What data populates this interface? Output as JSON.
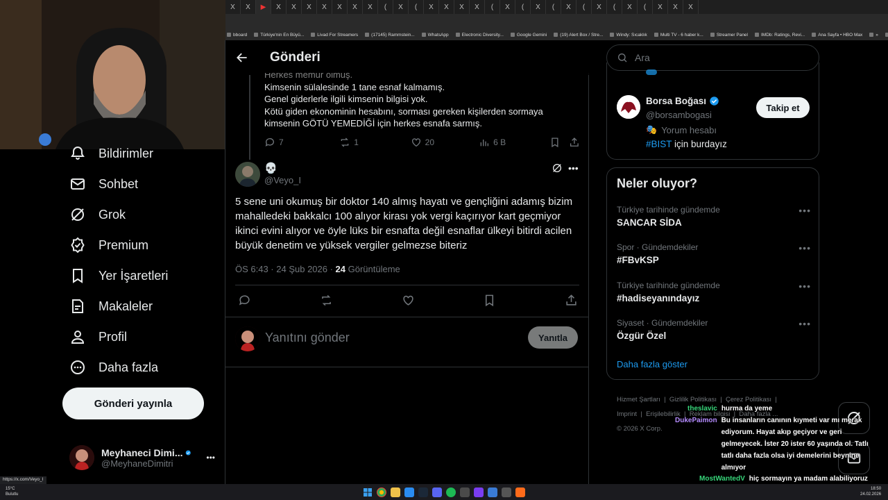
{
  "browser": {
    "tabs": [
      "X",
      "X",
      "▶",
      "X",
      "X",
      "X",
      "X",
      "X",
      "X",
      "X",
      "(",
      "X",
      "(",
      "X",
      "X",
      "X",
      "X",
      "(",
      "X",
      "(",
      "X",
      "(",
      "X",
      "(",
      "X",
      "(",
      "X",
      "(",
      "X",
      "X",
      "X"
    ],
    "bookmarks": [
      "bboard",
      "Türkiye'nin En Büyü...",
      "Livad For Streamers",
      "(17145) Rammstein...",
      "WhatsApp",
      "Electronic Diversity...",
      "Google Gemini",
      "(19) Alert Box / Stre...",
      "Windy: Sıcaklık",
      "Multi TV - 6 haber k...",
      "Streamer Panel",
      "IMDb: Ratings, Revi...",
      "Ana Sayfa • HBO Max",
      "»",
      "Tüm Yer İşaretleri"
    ]
  },
  "nav": {
    "items": [
      {
        "label": "Bildirimler",
        "icon": "bell-icon"
      },
      {
        "label": "Sohbet",
        "icon": "mail-icon"
      },
      {
        "label": "Grok",
        "icon": "grok-icon"
      },
      {
        "label": "Premium",
        "icon": "premium-icon"
      },
      {
        "label": "Yer İşaretleri",
        "icon": "bookmark-icon"
      },
      {
        "label": "Makaleler",
        "icon": "article-icon"
      },
      {
        "label": "Profil",
        "icon": "person-icon"
      },
      {
        "label": "Daha fazla",
        "icon": "more-icon"
      }
    ],
    "post_button": "Gönderi yayınla",
    "account": {
      "name": "Meyhaneci Dimi...",
      "handle": "@MeyhaneDimitri",
      "more": "•••"
    }
  },
  "main": {
    "title": "Gönderi",
    "quoted": {
      "lines": [
        "Herkes memur olmuş.",
        "Kimsenin sülalesinde 1 tane esnaf kalmamış.",
        "Genel giderlerle ilgili kimsenin bilgisi yok.",
        "Kötü giden ekonominin hesabını, sorması gereken kişilerden sormaya",
        "kimsenin GÖTÜ YEMEDİĞİ için herkes esnafa sarmış."
      ],
      "replies": "7",
      "reposts": "1",
      "likes": "20",
      "views": "6 B"
    },
    "tweet": {
      "name_emoji": "💀",
      "handle": "@Veyo_I",
      "text": "5 sene uni okumuş bir doktor 140 almış hayatı ve gençliğini adamış bizim mahalledeki bakkalcı 100 alıyor kirası yok vergi kaçırıyor kart geçmiyor ikinci evini alıyor ve öyle lüks bir esnafta değil esnaflar ülkeyi bitirdi acilen büyük denetim ve yüksek vergiler gelmezse biteriz",
      "time": "ÖS 6:43 · 24 Şub 2026 · ",
      "views_count": "24",
      "views_label": " Görüntüleme"
    },
    "reply": {
      "placeholder": "Yanıtını gönder",
      "button": "Yanıtla"
    }
  },
  "right": {
    "search_placeholder": "Ara",
    "suggestion": {
      "name": "Borsa Boğası",
      "handle": "@borsambogasi",
      "badge": "Yorum hesabı",
      "bio_tag": "#BIST",
      "bio_rest": " için burdayız",
      "follow": "Takip et"
    },
    "trends_title": "Neler oluyor?",
    "trends": [
      {
        "meta": "Türkiye tarihinde gündemde",
        "name": "SANCAR SİDA"
      },
      {
        "meta": "Spor · Gündemdekiler",
        "name": "#FBvKSP"
      },
      {
        "meta": "Türkiye tarihinde gündemde",
        "name": "#hadiseyanındayız"
      },
      {
        "meta": "Siyaset · Gündemdekiler",
        "name": "Özgür Özel"
      }
    ],
    "show_more": "Daha fazla göster",
    "footer": [
      "Hizmet Şartları",
      "Gizlilik Politikası",
      "Çerez Politikası",
      "Imprint",
      "Erişilebilirlik",
      "Reklam bilgisi",
      "Daha fazla ...",
      "© 2026 X Corp."
    ]
  },
  "chat": [
    {
      "user": "theslavic",
      "color": "#37d67a",
      "text": "hurma da yeme"
    },
    {
      "user": "DukePaimon",
      "color": "#b58cff",
      "text": "Bu insanların canının kıymeti var mı merak ediyorum. Hayat akıp geçiyor ve geri gelmeyecek. İster 20 ister 60 yaşında ol. Tatlı tatlı daha fazla olsa iyi demelerini beynine almıyor"
    },
    {
      "user": "MostWantedV",
      "color": "#37d67a",
      "text": "hiç sormayın ya madam alabiliyoruz niye boş şeylerle zaman harcıyoruz"
    }
  ],
  "statusbar": {
    "url": "https://x.com/Veyo_I"
  },
  "weather": {
    "temp": "15°C",
    "desc": "Bulutlu"
  },
  "clock": {
    "time": "18:50",
    "date": "24.02.2026"
  }
}
